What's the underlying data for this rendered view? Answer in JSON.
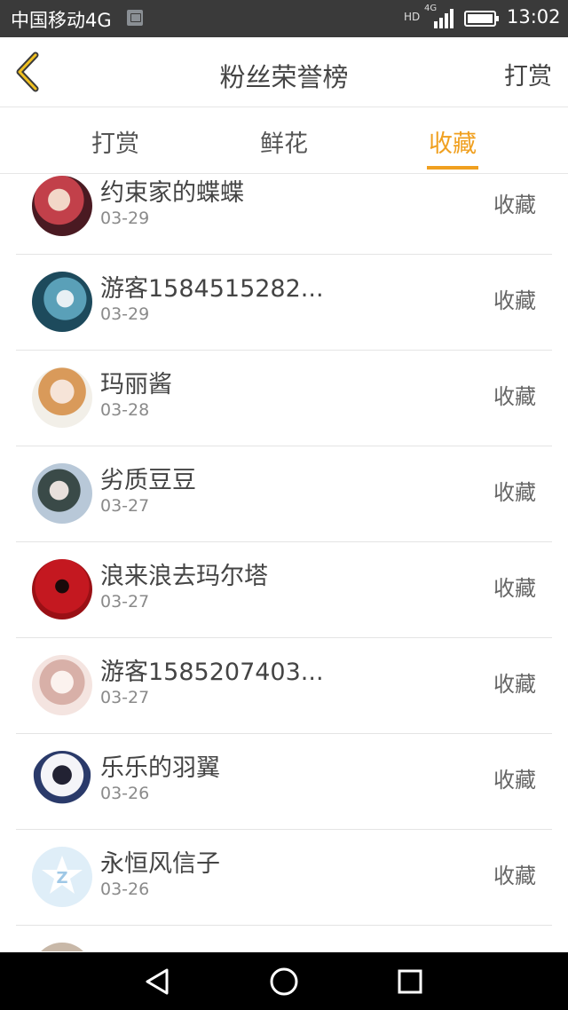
{
  "status_bar": {
    "carrier": "中国移动4G",
    "hd_label": "HD",
    "network_label": "4G",
    "time": "13:02"
  },
  "header": {
    "title": "粉丝荣誉榜",
    "right_action": "打赏"
  },
  "tabs": [
    {
      "label": "打赏",
      "active": false
    },
    {
      "label": "鲜花",
      "active": false
    },
    {
      "label": "收藏",
      "active": true
    }
  ],
  "list": [
    {
      "name": "约束家的蝶蝶",
      "date": "03-29",
      "action": "收藏"
    },
    {
      "name": "游客1584515282...",
      "date": "03-29",
      "action": "收藏"
    },
    {
      "name": "玛丽酱",
      "date": "03-28",
      "action": "收藏"
    },
    {
      "name": "劣质豆豆",
      "date": "03-27",
      "action": "收藏"
    },
    {
      "name": "浪来浪去玛尔塔",
      "date": "03-27",
      "action": "收藏"
    },
    {
      "name": "游客1585207403...",
      "date": "03-27",
      "action": "收藏"
    },
    {
      "name": "乐乐的羽翼",
      "date": "03-26",
      "action": "收藏"
    },
    {
      "name": "永恒风信子",
      "date": "03-26",
      "action": "收藏"
    }
  ],
  "colors": {
    "accent": "#f0a020",
    "status_bar_bg": "#3a3a3a",
    "nav_bar_bg": "#000000"
  }
}
